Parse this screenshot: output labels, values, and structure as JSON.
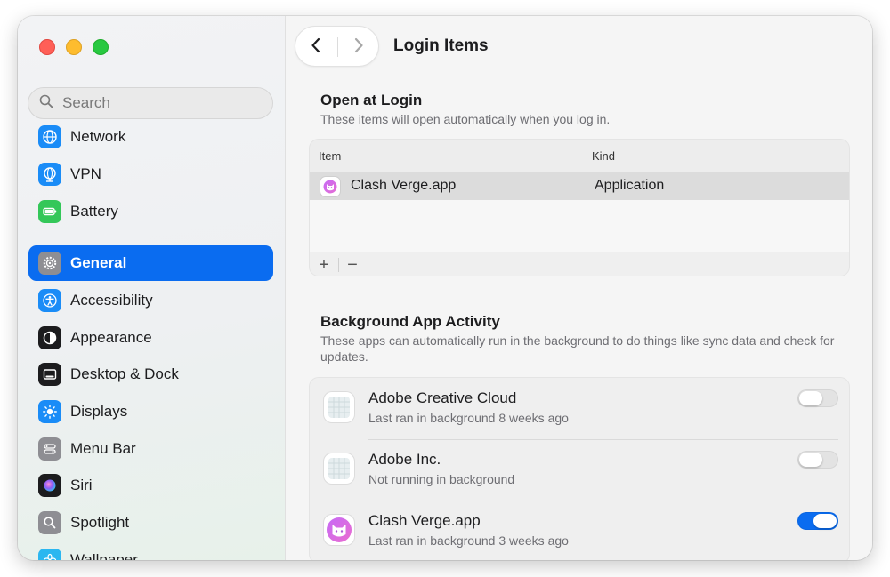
{
  "window": {
    "title": "Login Items"
  },
  "search": {
    "placeholder": "Search"
  },
  "sidebar": {
    "items": [
      {
        "label": "Network",
        "icon": "globe-icon"
      },
      {
        "label": "VPN",
        "icon": "vpn-globe-icon"
      },
      {
        "label": "Battery",
        "icon": "battery-icon"
      },
      {
        "label": "General",
        "icon": "gear-icon",
        "selected": true
      },
      {
        "label": "Accessibility",
        "icon": "accessibility-icon"
      },
      {
        "label": "Appearance",
        "icon": "appearance-icon"
      },
      {
        "label": "Desktop & Dock",
        "icon": "dock-icon"
      },
      {
        "label": "Displays",
        "icon": "sun-icon"
      },
      {
        "label": "Menu Bar",
        "icon": "menu-bar-icon"
      },
      {
        "label": "Siri",
        "icon": "siri-icon"
      },
      {
        "label": "Spotlight",
        "icon": "magnifier-icon"
      },
      {
        "label": "Wallpaper",
        "icon": "flower-icon"
      }
    ]
  },
  "open_at_login": {
    "title": "Open at Login",
    "subtitle": "These items will open automatically when you log in.",
    "columns": [
      "Item",
      "Kind"
    ],
    "rows": [
      {
        "item": "Clash Verge.app",
        "kind": "Application",
        "icon": "clash-verge-cat-icon"
      }
    ],
    "add_label": "+",
    "remove_label": "−"
  },
  "background_activity": {
    "title": "Background App Activity",
    "subtitle": "These apps can automatically run in the background to do things like sync data and check for updates.",
    "items": [
      {
        "name": "Adobe Creative Cloud",
        "status": "Last ran in background 8 weeks ago",
        "enabled": false,
        "icon": "generic-app-icon"
      },
      {
        "name": "Adobe Inc.",
        "status": "Not running in background",
        "enabled": false,
        "icon": "generic-app-icon"
      },
      {
        "name": "Clash Verge.app",
        "status": "Last ran in background 3 weeks ago",
        "enabled": true,
        "icon": "clash-verge-cat-icon"
      }
    ]
  },
  "colors": {
    "accent": "#0a6cf0",
    "close": "#ff5f57",
    "minimize": "#febc2e",
    "zoom": "#28c840"
  }
}
